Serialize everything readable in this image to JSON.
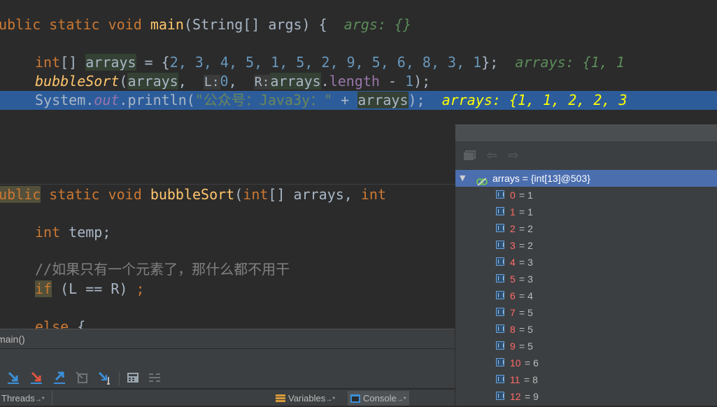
{
  "code": {
    "l1": {
      "kw1": "public",
      "kw2": "static",
      "kw3": "void",
      "fn": "main",
      "rest": "(String[] args) {",
      "hint": "args: {}"
    },
    "l2": {
      "kw": "int",
      "br": "[]",
      "var": "arrays",
      "eq": " = {",
      "nums": "2, 3, 4, 5, 1, 5, 2, 9, 5, 6, 8, 3, 1",
      "end": "};",
      "hint": "arrays: {1, 1"
    },
    "l3": {
      "fn": "bubbleSort",
      "open": "(",
      "var": "arrays",
      "comma": ",",
      "p1": "L:",
      "v1": "0",
      "comma2": ",",
      "p2": "R:",
      "var2": "arrays",
      "dot": ".",
      "fld": "length",
      "minus": " - ",
      "one": "1",
      "close": ");"
    },
    "l4": {
      "cls": "System",
      "dot": ".",
      "fld": "out",
      "call": ".println(",
      "str": "\"公众号：Java3y：\"",
      "plus": " + ",
      "var": "arrays",
      "close": ");",
      "hint": "arrays: {1, 1, 2, 2, 3"
    },
    "l5": {
      "brace": "}"
    },
    "l6": {
      "kw1": "public",
      "kw2": "static",
      "kw3": "void",
      "fn": "bubbleSort",
      "open": "(",
      "kw4": "int",
      "br": "[] arrays, ",
      "kw5": "int"
    },
    "l7": {
      "kw": "int",
      "rest": " temp;"
    },
    "l8": {
      "comment": "//如果只有一个元素了，那什么都不用干"
    },
    "l9": {
      "kw": "if",
      "rest": " (L == R) ",
      "semi": ";"
    },
    "l10": {
      "kw": "else",
      "rest": " {"
    }
  },
  "frames": {
    "current": "main()"
  },
  "tabs": {
    "threads": "Threads",
    "variables": "Variables",
    "console": "Console",
    "pin": "→*"
  },
  "variables": {
    "root": {
      "name": "arrays",
      "value": " = {int[13]@503}"
    },
    "items": [
      {
        "index": "0",
        "value": "1"
      },
      {
        "index": "1",
        "value": "1"
      },
      {
        "index": "2",
        "value": "2"
      },
      {
        "index": "3",
        "value": "2"
      },
      {
        "index": "4",
        "value": "3"
      },
      {
        "index": "5",
        "value": "3"
      },
      {
        "index": "6",
        "value": "4"
      },
      {
        "index": "7",
        "value": "5"
      },
      {
        "index": "8",
        "value": "5"
      },
      {
        "index": "9",
        "value": "5"
      },
      {
        "index": "10",
        "value": "6"
      },
      {
        "index": "11",
        "value": "8"
      },
      {
        "index": "12",
        "value": "9"
      }
    ]
  },
  "icons": {
    "step_over": "arrow-down-right-icon",
    "step_into": "step-into-icon",
    "step_out": "step-out-icon",
    "drop_frame": "drop-frame-icon",
    "run_to_cursor": "run-to-cursor-icon",
    "evaluate": "calculator-icon",
    "trace": "trace-icon",
    "nav_back": "arrow-left-icon",
    "nav_forward": "arrow-right-icon",
    "nav_frames": "frames-icon"
  },
  "colors": {
    "execution_line": "#2d5c9b",
    "selection": "#4b6eaf",
    "keyword": "#cc7832",
    "method": "#ffc66d",
    "number": "#6897bb"
  }
}
